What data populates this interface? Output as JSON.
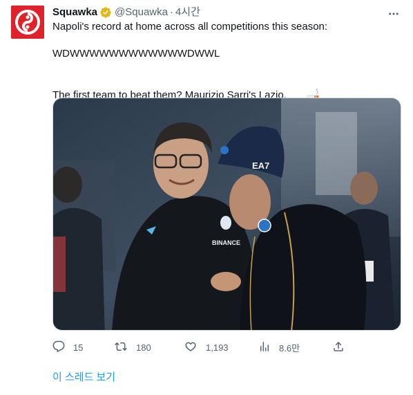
{
  "tweet": {
    "author_name": "Squawka",
    "handle": "@Squawka",
    "separator": "·",
    "time": "4시간",
    "text_line1": "Napoli's record at home across all competitions this season:",
    "text_line2": "WDWWWWWWWWWWWWDWWL",
    "text_line3": "The first team to beat them? Maurizio Sarri's Lazio.",
    "colors": {
      "brand": "#e0222a",
      "link": "#1d9bf0",
      "muted": "#536471",
      "verified": "#e2b719"
    }
  },
  "actions": {
    "reply_count": "15",
    "retweet_count": "180",
    "like_count": "1,193",
    "views_count": "8.6만"
  },
  "thread_link": "이 스레드 보기",
  "icons": {
    "avatar": "squawka-logo-icon",
    "verified": "verified-badge-icon",
    "more": "more-icon",
    "reply": "reply-icon",
    "retweet": "retweet-icon",
    "like": "heart-icon",
    "views": "views-icon",
    "share": "share-icon",
    "emoji": "cigarette-emoji-icon"
  }
}
